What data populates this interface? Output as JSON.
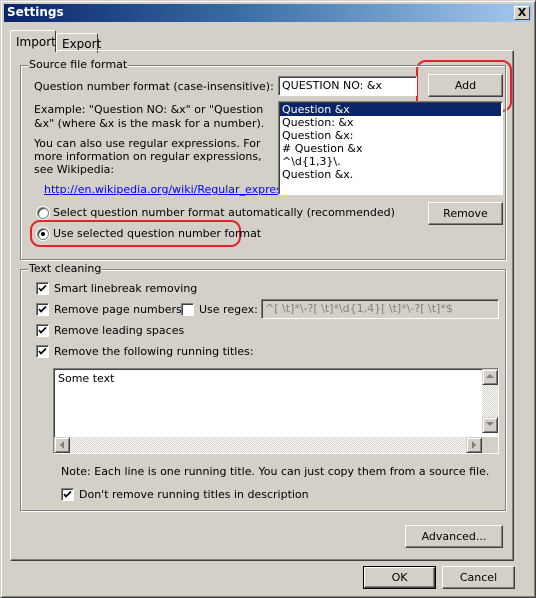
{
  "window": {
    "title": "Settings",
    "close_label": "X"
  },
  "tabs": [
    {
      "label": "Import",
      "active": true
    },
    {
      "label": "Export",
      "active": false
    }
  ],
  "source_file_format": {
    "group_label": "Source file format",
    "format_label": "Question number format (case-insensitive):",
    "format_input_value": "QUESTION NO: &x",
    "add_button": "Add",
    "example_line1": "Example: \"Question NO: &x\" or \"Question",
    "example_line2": "&x\" (where &x is the mask for a number).",
    "regex_line1": "You can also use regular expressions. For",
    "regex_line2": "more information on regular expressions,",
    "regex_line3": "see Wikipedia:",
    "wiki_link": "http://en.wikipedia.org/wiki/Regular_expression",
    "formats": [
      {
        "label": "Question &x",
        "selected": true
      },
      {
        "label": "Question: &x",
        "selected": false
      },
      {
        "label": "Question &x:",
        "selected": false
      },
      {
        "label": "# Question &x",
        "selected": false
      },
      {
        "label": "^\\d{1,3}\\.",
        "selected": false
      },
      {
        "label": "Question &x.",
        "selected": false
      }
    ],
    "remove_button": "Remove",
    "radio_auto": {
      "label": "Select question number format automatically (recommended)",
      "checked": false
    },
    "radio_selected": {
      "label": "Use selected question number format",
      "checked": true
    }
  },
  "text_cleaning": {
    "group_label": "Text cleaning",
    "smart_linebreak": {
      "label": "Smart linebreak removing",
      "checked": true
    },
    "remove_page_numbers": {
      "label": "Remove page numbers",
      "checked": true
    },
    "use_regex": {
      "label": "Use regex:",
      "checked": false
    },
    "regex_value": "^[ \\t]*\\-?[ \\t]*\\d{1,4}[ \\t]*\\-?[ \\t]*$",
    "remove_leading_spaces": {
      "label": "Remove leading spaces",
      "checked": true
    },
    "remove_running_titles": {
      "label": "Remove the following running titles:",
      "checked": true
    },
    "running_titles_text": "Some text",
    "note": "Note: Each line is one running title. You can just copy them from a source file.",
    "dont_remove_in_description": {
      "label": "Don't remove running titles in description",
      "checked": true
    }
  },
  "advanced_button": "Advanced...",
  "ok_button": "OK",
  "cancel_button": "Cancel",
  "annotation_color": "#e8202a"
}
